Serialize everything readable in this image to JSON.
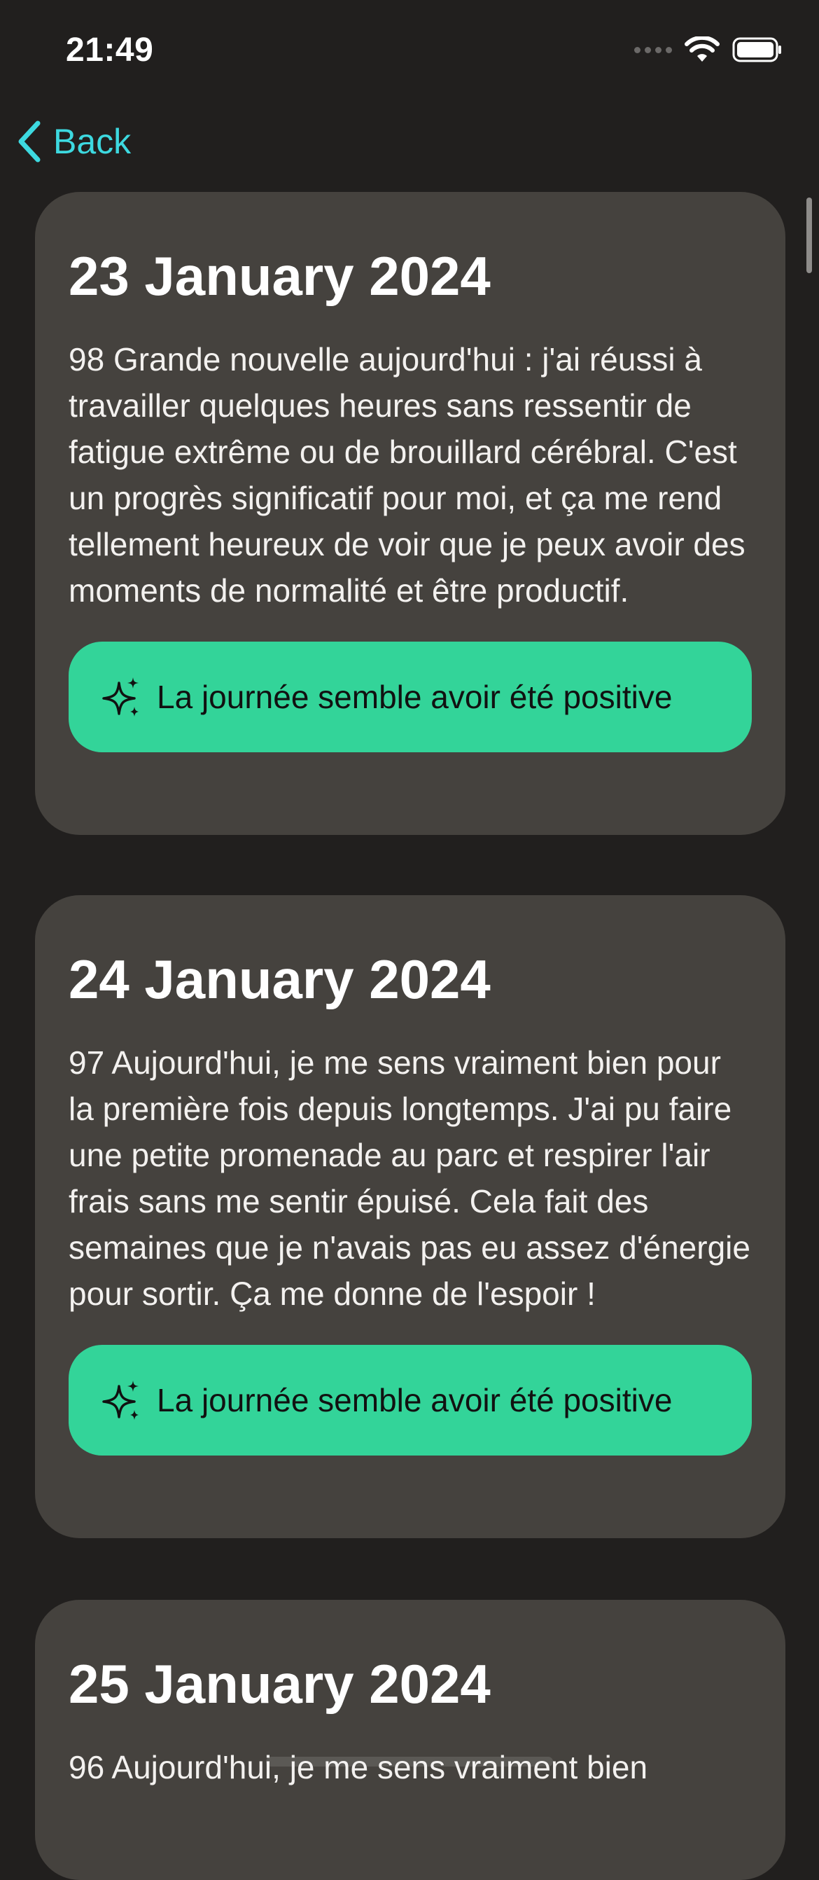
{
  "status_bar": {
    "time": "21:49"
  },
  "nav": {
    "back_label": "Back"
  },
  "colors": {
    "background": "#211f1e",
    "card": "#45423e",
    "accent": "#3dd9e0",
    "positive": "#33d499"
  },
  "entries": [
    {
      "date": "23 January 2024",
      "text": "98 Grande nouvelle aujourd'hui : j'ai réussi à travailler quelques heures sans ressentir de fatigue extrême ou de brouillard cérébral. C'est un progrès significatif pour moi, et ça me rend tellement heureux de voir que je peux avoir des moments de normalité et être productif.",
      "sentiment": "La journée semble avoir été positive",
      "icon": "sparkles-icon"
    },
    {
      "date": "24 January 2024",
      "text": "97 Aujourd'hui, je me sens vraiment bien pour la première fois depuis longtemps. J'ai pu faire une petite promenade au parc et respirer l'air frais sans me sentir épuisé. Cela fait des semaines que je n'avais pas eu assez d'énergie pour sortir. Ça me donne de l'espoir !",
      "sentiment": "La journée semble avoir été positive",
      "icon": "sparkles-icon"
    },
    {
      "date": "25 January 2024",
      "text": "96 Aujourd'hui, je me sens vraiment bien",
      "sentiment": "",
      "icon": ""
    }
  ]
}
